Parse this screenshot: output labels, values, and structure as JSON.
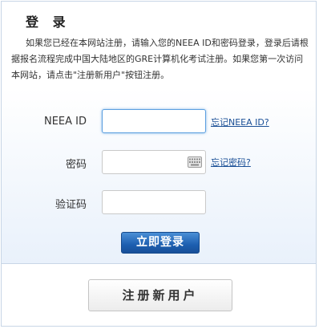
{
  "title": "登 录",
  "intro": "如果您已经在本网站注册，请输入您的NEEA ID和密码登录，登录后请根据报名流程完成中国大陆地区的GRE计算机化考试注册。如果您第一次访问本网站，请点击\"注册新用户\"按钮注册。",
  "form": {
    "neea_id": {
      "label": "NEEA ID",
      "value": "",
      "link": "忘记NEEA ID?"
    },
    "password": {
      "label": "密码",
      "value": "",
      "link": "忘记密码?"
    },
    "captcha": {
      "label": "验证码",
      "value": ""
    }
  },
  "buttons": {
    "login": "立即登录",
    "register": "注册新用户"
  },
  "icons": {
    "password_field": "keyboard-icon"
  }
}
